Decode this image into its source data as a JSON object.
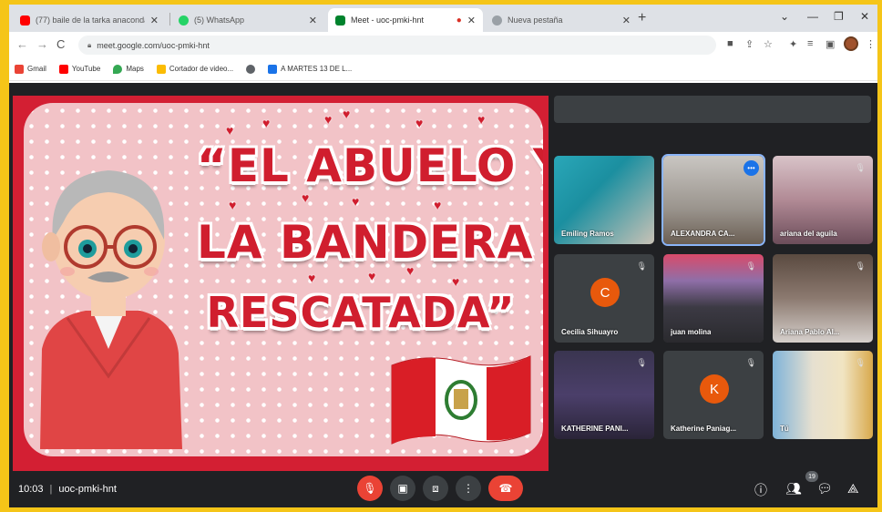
{
  "browser": {
    "tabs": [
      {
        "title": "(77) baile de la tarka anaconda -",
        "favicon_color": "#ff0000"
      },
      {
        "title": "(5) WhatsApp",
        "favicon_color": "#25d366"
      },
      {
        "title": "Meet - uoc-pmki-hnt",
        "favicon_color": "#00832d",
        "active": true
      },
      {
        "title": "Nueva pestaña",
        "favicon_color": "#5f6368"
      }
    ],
    "url": "meet.google.com/uoc-pmki-hnt",
    "bookmarks": [
      {
        "label": "Gmail",
        "color": "#ea4335"
      },
      {
        "label": "YouTube",
        "color": "#ff0000"
      },
      {
        "label": "Maps",
        "color": "#34a853"
      },
      {
        "label": "Cortador de video...",
        "color": "#fbbc04"
      },
      {
        "label": "",
        "color": "#5f6368"
      },
      {
        "label": "A MARTES 13 DE L...",
        "color": "#1a73e8"
      }
    ]
  },
  "slide": {
    "line1": "“EL ABUELO Y",
    "line2": "LA BANDERA",
    "line3": "RESCATADA”"
  },
  "participants": [
    {
      "name": "Emiling Ramos",
      "type": "video",
      "muted": false
    },
    {
      "name": "ALEXANDRA CA...",
      "type": "video",
      "speaking": true,
      "muted": false
    },
    {
      "name": "ariana del aguila",
      "type": "video",
      "muted": true
    },
    {
      "name": "Cecilia Sihuayro",
      "type": "avatar",
      "initial": "C",
      "muted": true
    },
    {
      "name": "juan molina",
      "type": "video",
      "muted": true
    },
    {
      "name": "Ariana Pablo Al...",
      "type": "video",
      "muted": true
    },
    {
      "name": "KATHERINE PANI...",
      "type": "video",
      "muted": true
    },
    {
      "name": "Katherine Paniag...",
      "type": "avatar",
      "initial": "K",
      "muted": true
    },
    {
      "name": "Tú",
      "type": "video",
      "muted": true
    }
  ],
  "meeting": {
    "time": "10:03",
    "code": "uoc-pmki-hnt",
    "participant_count": "19"
  },
  "colors": {
    "meet_bg": "#202124",
    "tile_bg": "#3c4043",
    "end_call": "#ea4335",
    "slide_red": "#d31f33",
    "frame_yellow": "#f5c518"
  }
}
